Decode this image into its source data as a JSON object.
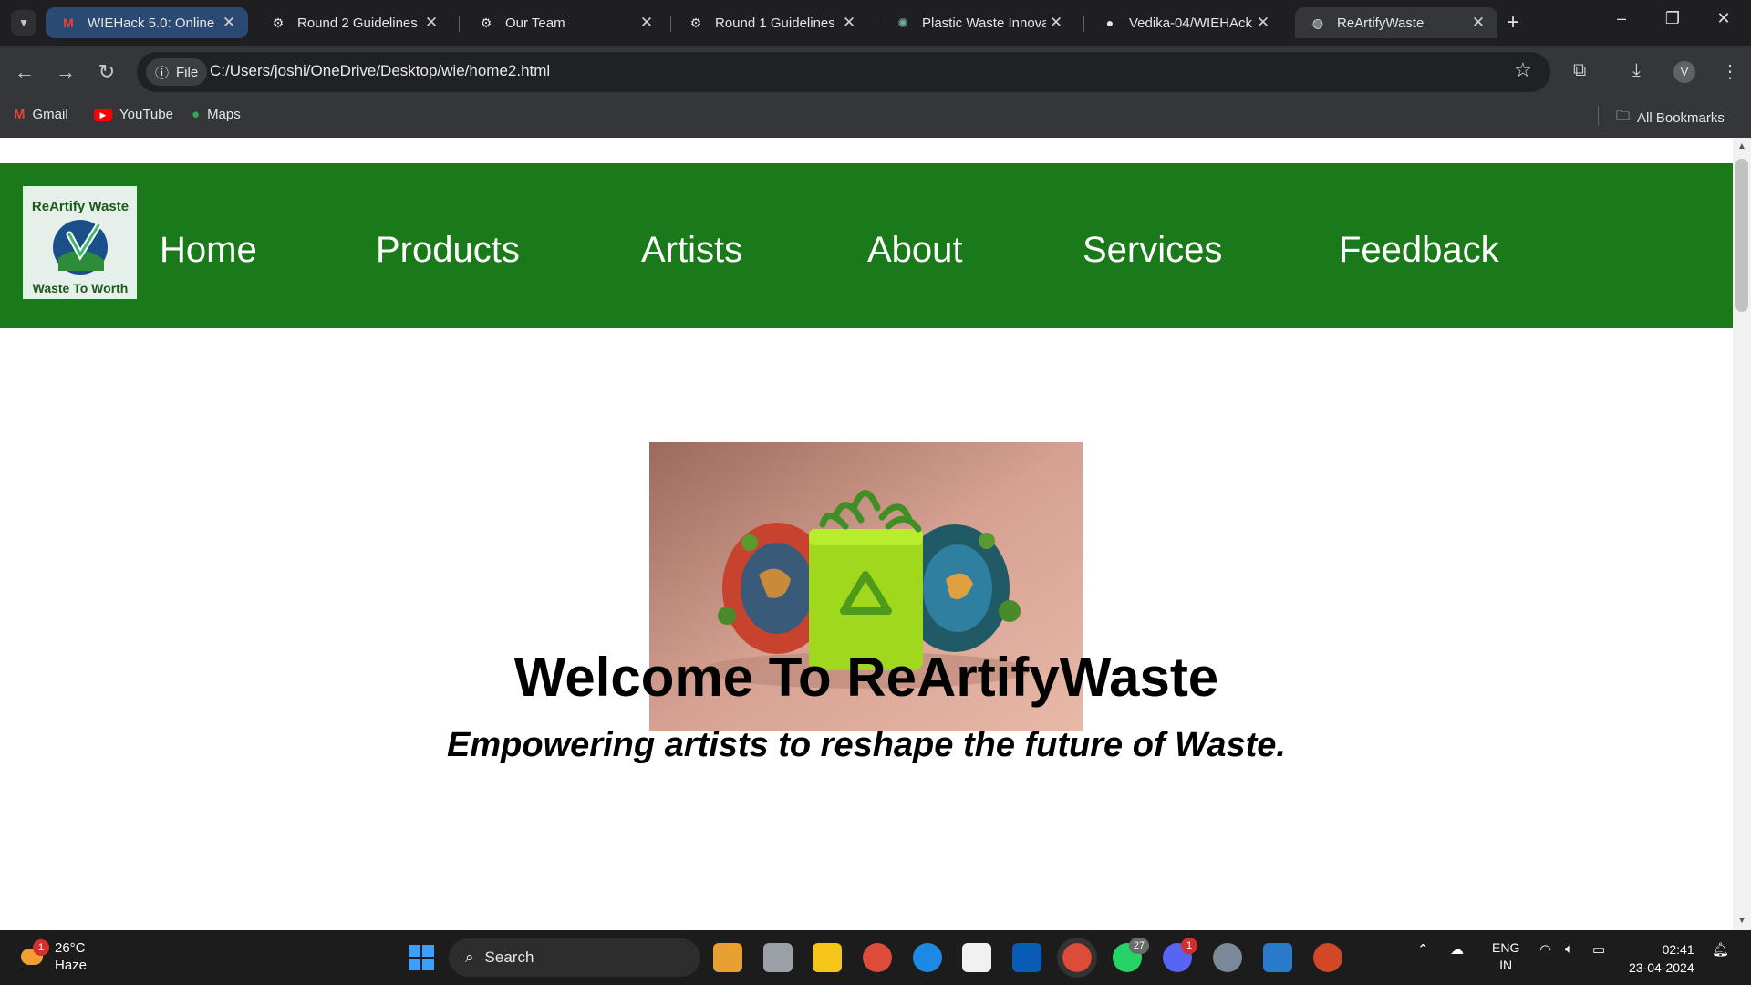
{
  "browser": {
    "tabs": [
      {
        "title": "WIEHack 5.0: Online",
        "icon": "gmail-icon"
      },
      {
        "title": "Round 2 Guidelines",
        "icon": "unstop-icon"
      },
      {
        "title": "Our Team",
        "icon": "unstop-icon"
      },
      {
        "title": "Round 1 Guidelines",
        "icon": "unstop-icon"
      },
      {
        "title": "Plastic Waste Innova",
        "icon": "chatgpt-icon"
      },
      {
        "title": "Vedika-04/WIEHAck",
        "icon": "github-icon"
      },
      {
        "title": "ReArtifyWaste",
        "icon": "globe-icon"
      }
    ],
    "new_tab": "+",
    "file_chip": "File",
    "url": "C:/Users/joshi/OneDrive/Desktop/wie/home2.html",
    "profile_initial": "V",
    "bookmarks": [
      "Gmail",
      "YouTube",
      "Maps"
    ],
    "all_bookmarks": "All Bookmarks"
  },
  "site": {
    "logo": {
      "top_text": "ReArtify Waste",
      "bottom_text": "Waste To Worth"
    },
    "nav": [
      "Home",
      "Products",
      "Artists",
      "About",
      "Services",
      "Feedback"
    ],
    "heading": "Welcome To ReArtifyWaste",
    "tagline": "Empowering artists to reshape the future of Waste.",
    "brand_color": "#1a7a1a"
  },
  "taskbar": {
    "weather_temp": "26°C",
    "weather_desc": "Haze",
    "weather_badge": "1",
    "search_placeholder": "Search",
    "whatsapp_badge": "27",
    "discord_badge": "1",
    "lang_top": "ENG",
    "lang_bottom": "IN",
    "time": "02:41",
    "date": "23-04-2024"
  }
}
